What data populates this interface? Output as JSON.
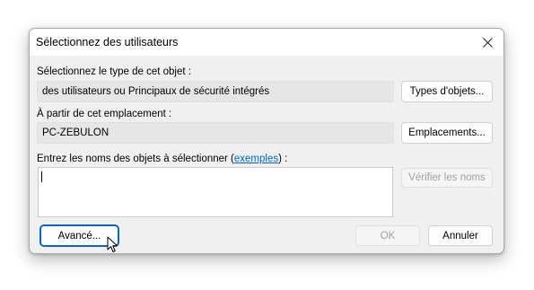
{
  "window": {
    "title": "Sélectionnez des utilisateurs",
    "close_icon": "close-icon"
  },
  "object_type": {
    "label": "Sélectionnez le type de cet objet :",
    "value": "des utilisateurs ou Principaux de sécurité intégrés",
    "button": "Types d'objets..."
  },
  "location": {
    "label": "À partir de cet emplacement :",
    "value": "PC-ZEBULON",
    "button": "Emplacements..."
  },
  "names": {
    "label_prefix": "Entrez les noms des objets à sélectionner (",
    "link": "exemples",
    "label_suffix": ") :",
    "value": "",
    "check_button": "Vérifier les noms"
  },
  "footer": {
    "advanced_button": "Avancé...",
    "ok_button": "OK",
    "cancel_button": "Annuler"
  },
  "cursor_icon": "mouse-pointer-icon"
}
